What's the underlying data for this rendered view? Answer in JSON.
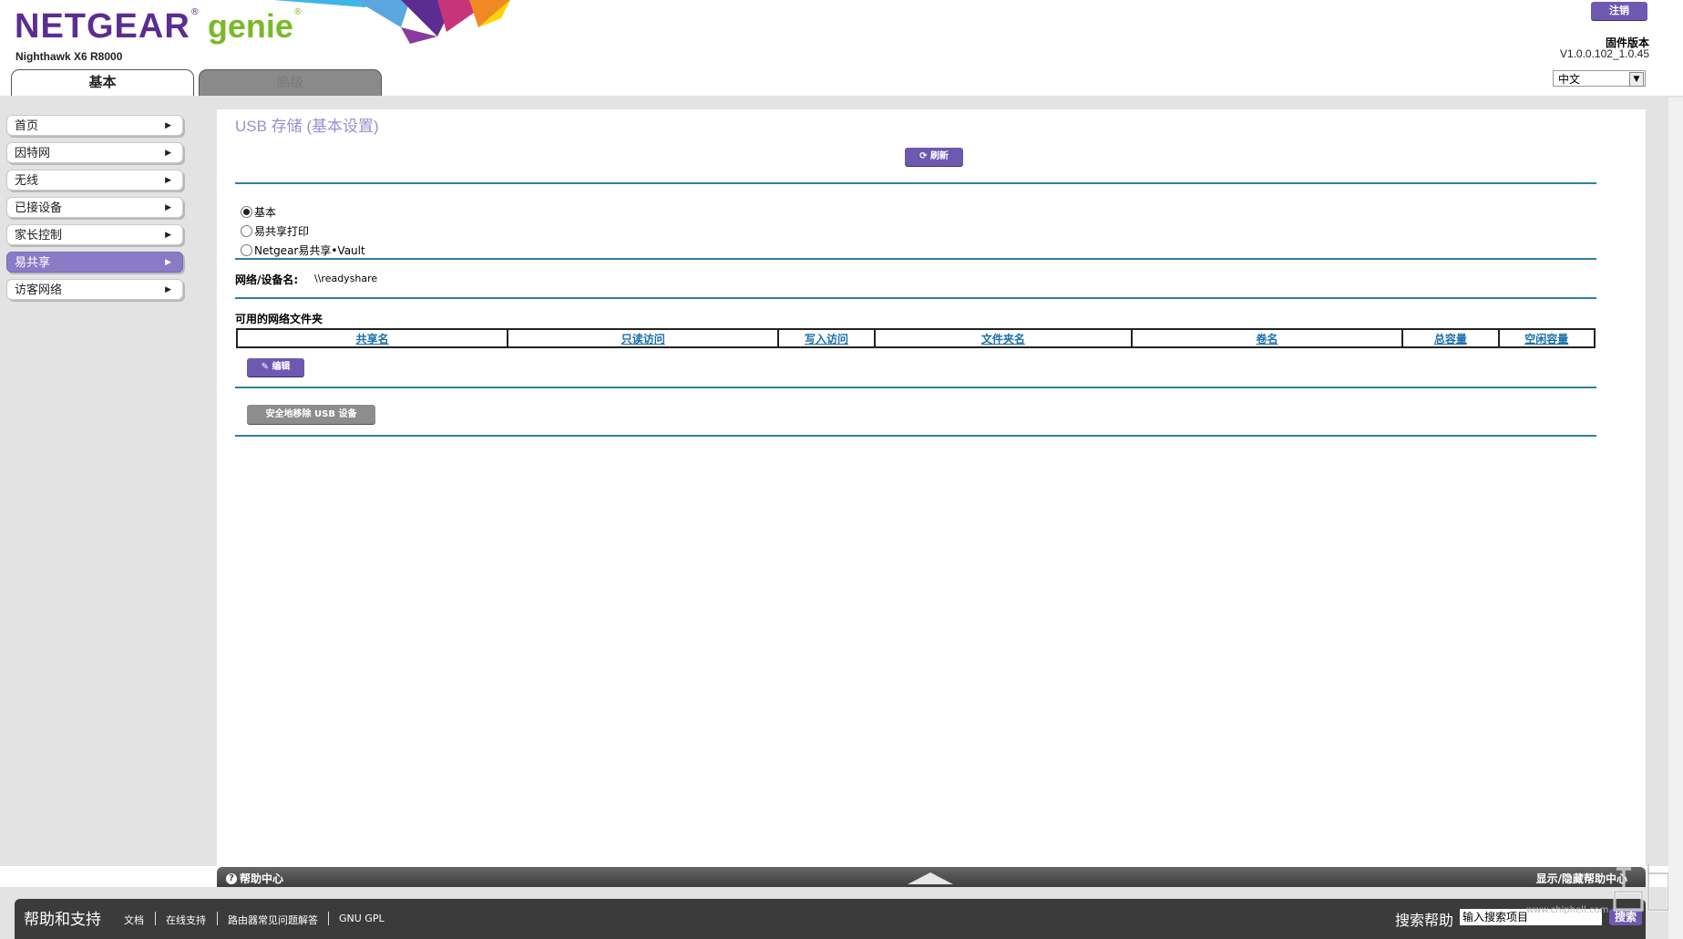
{
  "header": {
    "brand": "NETGEAR",
    "brand_reg": "®",
    "product": "genie",
    "product_reg": "®",
    "model": "Nighthawk X6 R8000",
    "tabs": [
      {
        "label": "基本",
        "active": true
      },
      {
        "label": "高级",
        "active": false
      }
    ],
    "logout_label": "注销",
    "firmware_label": "固件版本",
    "firmware_version": "V1.0.0.102_1.0.45",
    "language_selected": "中文",
    "deco_colors": [
      "#5c2d91",
      "#c8347a",
      "#f08a24",
      "#ffd400",
      "#3fb6e8"
    ]
  },
  "sidebar": {
    "items": [
      {
        "label": "首页",
        "active": false
      },
      {
        "label": "因特网",
        "active": false
      },
      {
        "label": "无线",
        "active": false
      },
      {
        "label": "已接设备",
        "active": false
      },
      {
        "label": "家长控制",
        "active": false
      },
      {
        "label": "易共享",
        "active": true
      },
      {
        "label": "访客网络",
        "active": false
      }
    ]
  },
  "main": {
    "title": "USB 存储 (基本设置)",
    "refresh_label": "刷新",
    "mode_options": [
      {
        "label": "基本",
        "checked": true
      },
      {
        "label": "易共享打印",
        "checked": false
      },
      {
        "label": "Netgear易共享•Vault",
        "checked": false
      }
    ],
    "device_name_label": "网络/设备名:",
    "device_name_value": "\\\\readyshare",
    "folders_title": "可用的网络文件夹",
    "table_headers": [
      "共享名",
      "只读访问",
      "写入访问",
      "文件夹名",
      "卷名",
      "总容量",
      "空闲容量"
    ],
    "edit_label": "编辑",
    "remove_usb_label": "安全地移除 USB 设备"
  },
  "help_bar": {
    "help_center_label": "帮助中心",
    "toggle_label": "显示/隐藏帮助中心"
  },
  "footer": {
    "title": "帮助和支持",
    "links": [
      "文档",
      "在线支持",
      "路由器常见问题解答",
      "GNU GPL"
    ],
    "search_label": "搜索帮助",
    "search_placeholder": "输入搜索项目",
    "search_button": "搜索"
  },
  "colors": {
    "accent_purple": "#6d5ab0",
    "active_nav": "#8a7bc6",
    "divider_blue": "#2d7fa1",
    "header_link_blue": "#1a6fae"
  },
  "watermark": "www.chiphell.com"
}
